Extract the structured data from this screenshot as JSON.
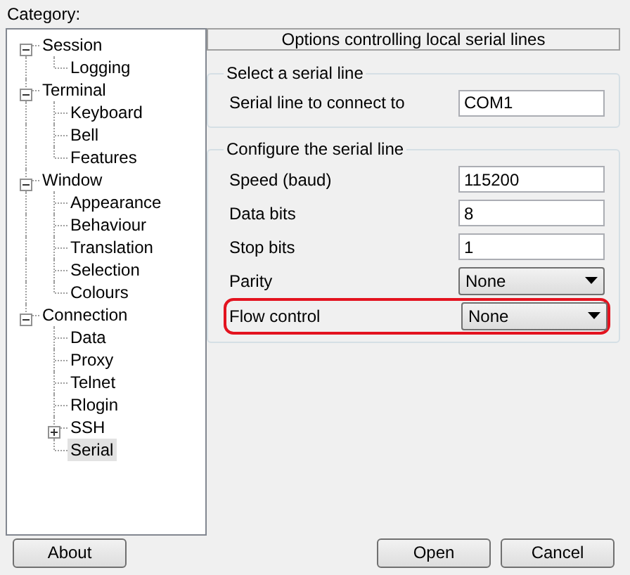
{
  "category_label": "Category:",
  "tree": [
    {
      "label": "Session",
      "expanded": true,
      "selected": false,
      "children": [
        {
          "label": "Logging",
          "selected": false
        }
      ]
    },
    {
      "label": "Terminal",
      "expanded": true,
      "selected": false,
      "children": [
        {
          "label": "Keyboard",
          "selected": false
        },
        {
          "label": "Bell",
          "selected": false
        },
        {
          "label": "Features",
          "selected": false
        }
      ]
    },
    {
      "label": "Window",
      "expanded": true,
      "selected": false,
      "children": [
        {
          "label": "Appearance",
          "selected": false
        },
        {
          "label": "Behaviour",
          "selected": false
        },
        {
          "label": "Translation",
          "selected": false
        },
        {
          "label": "Selection",
          "selected": false
        },
        {
          "label": "Colours",
          "selected": false
        }
      ]
    },
    {
      "label": "Connection",
      "expanded": true,
      "selected": false,
      "children": [
        {
          "label": "Data",
          "selected": false
        },
        {
          "label": "Proxy",
          "selected": false
        },
        {
          "label": "Telnet",
          "selected": false
        },
        {
          "label": "Rlogin",
          "selected": false
        },
        {
          "label": "SSH",
          "expanded": false,
          "selected": false
        },
        {
          "label": "Serial",
          "selected": true
        }
      ]
    }
  ],
  "panel_title": "Options controlling local serial lines",
  "groups": [
    {
      "title": "Select a serial line",
      "rows": [
        {
          "label": "Serial line to connect to",
          "kind": "text",
          "value": "COM1",
          "highlighted": false
        }
      ]
    },
    {
      "title": "Configure the serial line",
      "rows": [
        {
          "label": "Speed (baud)",
          "kind": "text",
          "value": "115200",
          "highlighted": false
        },
        {
          "label": "Data bits",
          "kind": "text",
          "value": "8",
          "highlighted": false
        },
        {
          "label": "Stop bits",
          "kind": "text",
          "value": "1",
          "highlighted": false
        },
        {
          "label": "Parity",
          "kind": "select",
          "value": "None",
          "highlighted": false
        },
        {
          "label": "Flow control",
          "kind": "select",
          "value": "None",
          "highlighted": true
        }
      ]
    }
  ],
  "buttons_left": [
    "About"
  ],
  "buttons_right": [
    "Open",
    "Cancel"
  ]
}
